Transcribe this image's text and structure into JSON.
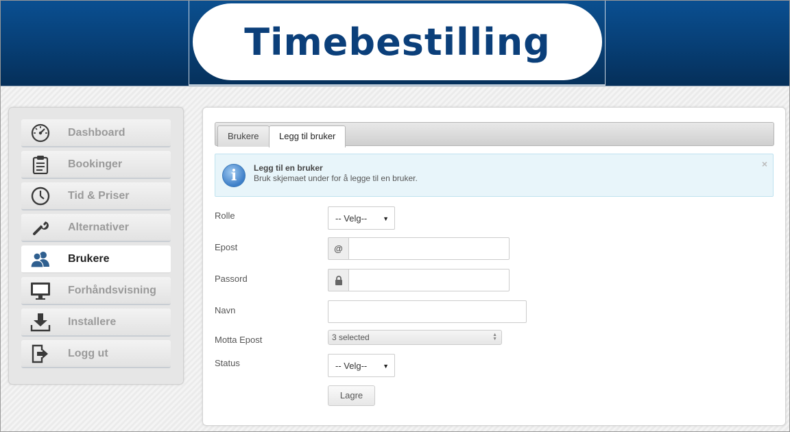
{
  "header": {
    "title": "Timebestilling"
  },
  "sidebar": {
    "items": [
      {
        "label": "Dashboard",
        "icon": "dashboard-gauge-icon"
      },
      {
        "label": "Bookinger",
        "icon": "clipboard-icon"
      },
      {
        "label": "Tid & Priser",
        "icon": "clock-icon"
      },
      {
        "label": "Alternativer",
        "icon": "wrench-icon"
      },
      {
        "label": "Brukere",
        "icon": "users-icon",
        "active": true
      },
      {
        "label": "Forhåndsvisning",
        "icon": "monitor-icon"
      },
      {
        "label": "Installere",
        "icon": "download-icon"
      },
      {
        "label": "Logg ut",
        "icon": "logout-icon"
      }
    ]
  },
  "tabs": [
    {
      "label": "Brukere",
      "active": false
    },
    {
      "label": "Legg til bruker",
      "active": true
    }
  ],
  "alert": {
    "title": "Legg til en bruker",
    "text": "Bruk skjemaet under for å legge til en bruker.",
    "icon_glyph": "i",
    "close_glyph": "×"
  },
  "form": {
    "rolle": {
      "label": "Rolle",
      "value": "-- Velg--"
    },
    "epost": {
      "label": "Epost",
      "addon": "@",
      "value": ""
    },
    "passord": {
      "label": "Passord",
      "value": ""
    },
    "navn": {
      "label": "Navn",
      "value": ""
    },
    "motta_epost": {
      "label": "Motta Epost",
      "value": "3 selected"
    },
    "status": {
      "label": "Status",
      "value": "-- Velg--"
    },
    "submit_label": "Lagre"
  },
  "colors": {
    "header_blue": "#0a4f91",
    "logo_text": "#0b3f7a",
    "icon_dark": "#3a3a3a",
    "users_icon_blue": "#2f5f8f"
  }
}
